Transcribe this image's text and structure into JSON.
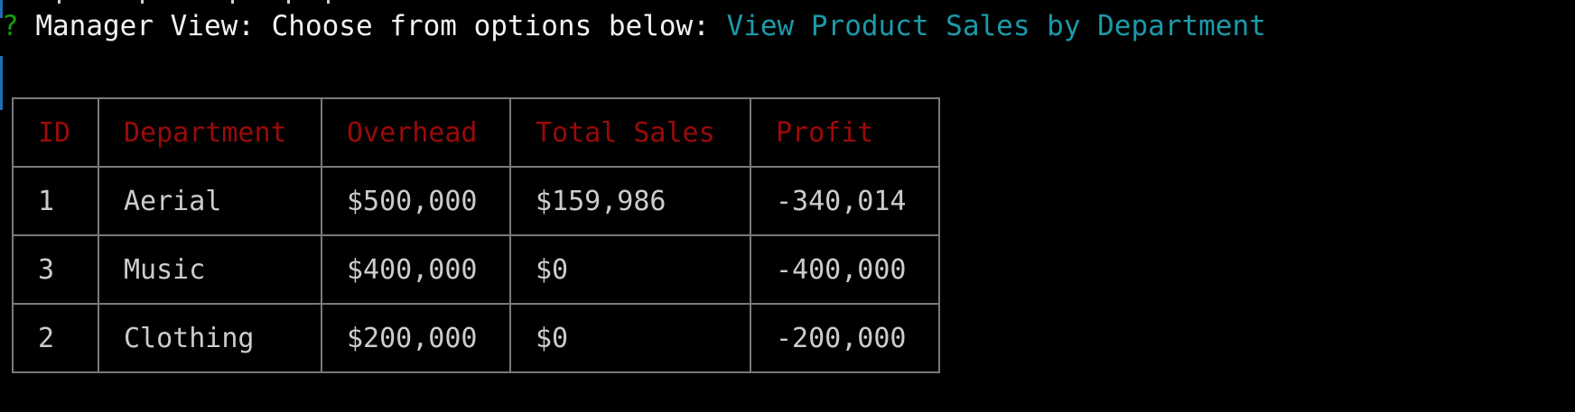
{
  "prompt": {
    "symbol": "?",
    "question": " Manager View: Choose from options below: ",
    "answer": "View Product Sales by Department"
  },
  "table": {
    "headers": [
      "ID",
      "Department",
      "Overhead",
      "Total Sales",
      "Profit"
    ],
    "rows": [
      [
        "1",
        "Aerial",
        "$500,000",
        "$159,986",
        "-340,014"
      ],
      [
        "3",
        "Music",
        "$400,000",
        "$0",
        "-400,000"
      ],
      [
        "2",
        "Clothing",
        "$200,000",
        "$0",
        "-200,000"
      ]
    ]
  },
  "colors": {
    "background": "#000000",
    "prompt_symbol": "#13a10e",
    "prompt_text": "#f2f2f2",
    "answer": "#1b9aaa",
    "header_text": "#9a0a0a",
    "cell_text": "#cccccc",
    "border": "#7a7a7a"
  }
}
